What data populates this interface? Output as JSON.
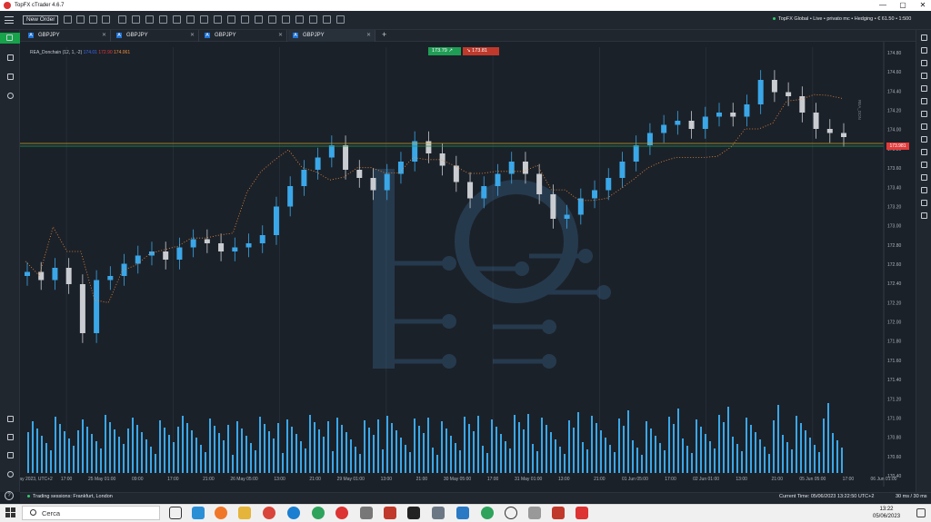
{
  "window": {
    "title": "TopFX cTrader 4.6.7",
    "minimize": "—",
    "maximize": "▢",
    "close": "✕"
  },
  "toolbar": {
    "new_order_label": "New Order",
    "account_info": "TopFX Global • Live • privato mc • Hedging • € 61.50 • 1:500"
  },
  "tabs": [
    {
      "symbol": "GBPJPY",
      "active": false
    },
    {
      "symbol": "GBPJPY",
      "active": false
    },
    {
      "symbol": "GBPJPY",
      "active": false
    },
    {
      "symbol": "GBPJPY",
      "active": true
    }
  ],
  "tab_add_label": "+",
  "chart": {
    "indicator": {
      "name": "REA_Donchain (12, 1, -2)",
      "upper": "174.01",
      "lower": "172.90",
      "mid": "174.061"
    },
    "sell_price": "173.79",
    "buy_price": "173.81",
    "current_price_tag": "173.981",
    "price_axis_label": "REA_DON",
    "colors": {
      "upper": "#1f2fd6",
      "lower": "#e01b1b",
      "mid": "#f08c3a",
      "bull": "#3aa7e8",
      "bear": "#c9ccd1",
      "volume": "#3aa7e8"
    }
  },
  "chart_data": {
    "type": "candlestick",
    "symbol": "GBPJPY",
    "y_ticks": [
      "174.80",
      "174.60",
      "174.40",
      "174.20",
      "174.00",
      "173.80",
      "173.60",
      "173.40",
      "173.20",
      "173.00",
      "172.80",
      "172.60",
      "172.40",
      "172.20",
      "172.00",
      "171.80",
      "171.60",
      "171.40",
      "171.20",
      "171.00",
      "170.80",
      "170.60",
      "170.40"
    ],
    "x_ticks": [
      "24 May 2023, UTC+2",
      "17:00",
      "25 May 01:00",
      "09:00",
      "17:00",
      "21:00",
      "26 May 05:00",
      "13:00",
      "21:00",
      "29 May 01:00",
      "13:00",
      "21:00",
      "30 May 05:00",
      "17:00",
      "31 May 01:00",
      "13:00",
      "21:00",
      "01 Jun 05:00",
      "17:00",
      "02 Jun 01:00",
      "13:00",
      "21:00",
      "05 Jun 05:00",
      "17:00",
      "06 Jun 01:00"
    ],
    "ylim": [
      170.3,
      174.9
    ],
    "series": [
      {
        "name": "upper",
        "y": [
          172.36,
          172.36,
          173.55,
          173.55,
          173.55,
          172.36,
          172.3,
          172.45,
          172.55,
          172.7,
          172.74,
          172.78,
          172.95,
          172.95,
          172.95,
          172.95,
          173.7,
          173.75,
          173.84,
          173.84,
          173.6,
          173.6,
          173.5,
          173.57,
          173.75,
          173.75,
          173.62,
          173.62,
          174.05,
          174.05,
          174.05,
          173.9,
          173.71,
          173.71,
          173.71,
          173.71,
          173.71,
          173.71,
          173.71,
          173.71,
          173.45,
          173.45,
          173.5,
          173.65,
          173.9,
          173.9,
          174.05,
          174.05,
          174.05,
          174.05,
          174.08,
          174.08,
          174.08,
          174.08,
          174.2,
          174.7,
          174.7,
          174.7,
          174.52,
          174.5
        ]
      },
      {
        "name": "lower",
        "y": [
          172.2,
          171.85,
          171.85,
          171.25,
          171.25,
          171.25,
          171.25,
          171.88,
          171.92,
          172.05,
          172.1,
          172.15,
          172.18,
          172.18,
          172.25,
          172.3,
          172.55,
          173.0,
          173.2,
          173.45,
          173.25,
          173.15,
          173.05,
          173.05,
          173.1,
          173.1,
          173.1,
          173.1,
          173.05,
          173.0,
          173.0,
          173.0,
          173.0,
          173.0,
          173.05,
          173.05,
          173.05,
          173.2,
          172.6,
          172.6,
          172.6,
          172.6,
          172.6,
          172.68,
          172.68,
          172.95,
          172.95,
          173.05,
          173.05,
          173.05,
          173.05,
          173.28,
          173.72,
          173.72,
          173.74,
          173.78,
          173.82,
          173.94,
          174.1,
          174.05
        ]
      }
    ],
    "ohlc_close": [
      172.15,
      172.05,
      172.2,
      172.0,
      171.4,
      172.05,
      172.1,
      172.25,
      172.35,
      172.4,
      172.3,
      172.45,
      172.55,
      172.5,
      172.4,
      172.45,
      172.5,
      172.6,
      172.95,
      173.2,
      173.4,
      173.55,
      173.7,
      173.4,
      173.3,
      173.15,
      173.35,
      173.5,
      173.75,
      173.6,
      173.45,
      173.25,
      173.05,
      173.2,
      173.35,
      173.5,
      173.35,
      173.1,
      172.8,
      172.85,
      173.05,
      173.15,
      173.3,
      173.5,
      173.7,
      173.85,
      173.95,
      174.0,
      173.9,
      174.05,
      174.1,
      174.05,
      174.2,
      174.5,
      174.35,
      174.3,
      174.1,
      173.9,
      173.85,
      173.8
    ]
  },
  "status": {
    "sessions": "Trading sessions: Frankfurt, London",
    "current_time": "Current Time: 05/06/2023 13:22:50   UTC+2",
    "latency": "30 ms / 30 ms",
    "help": "?"
  },
  "taskbar": {
    "search_text": "Cerca",
    "time": "13:22",
    "date": "05/06/2023"
  }
}
